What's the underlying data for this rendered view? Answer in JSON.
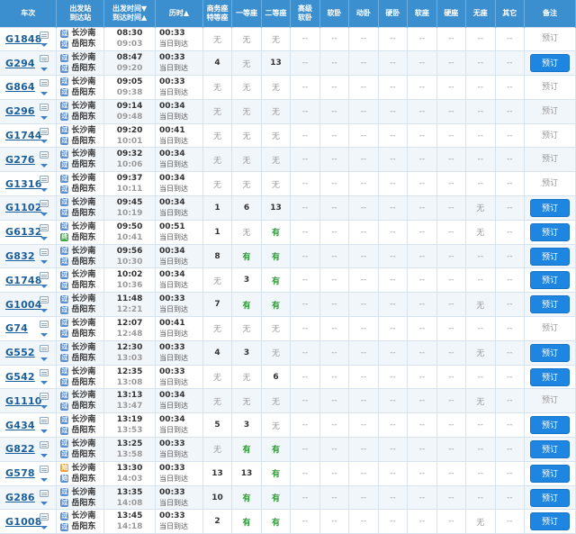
{
  "header": [
    {
      "key": "train",
      "lines": [
        "车次"
      ]
    },
    {
      "key": "station",
      "lines": [
        "出发站",
        "到达站"
      ]
    },
    {
      "key": "time",
      "lines": [
        "出发时间▼",
        "到达时间▲"
      ]
    },
    {
      "key": "duration",
      "lines": [
        "历时▲"
      ]
    },
    {
      "key": "biz",
      "lines": [
        "商务座",
        "特等座"
      ]
    },
    {
      "key": "first",
      "lines": [
        "一等座"
      ]
    },
    {
      "key": "second",
      "lines": [
        "二等座"
      ]
    },
    {
      "key": "gjrw",
      "lines": [
        "高级",
        "软卧"
      ]
    },
    {
      "key": "rw",
      "lines": [
        "软卧"
      ]
    },
    {
      "key": "dw",
      "lines": [
        "动卧"
      ]
    },
    {
      "key": "yw",
      "lines": [
        "硬卧"
      ]
    },
    {
      "key": "rz",
      "lines": [
        "软座"
      ]
    },
    {
      "key": "yz",
      "lines": [
        "硬座"
      ]
    },
    {
      "key": "wz",
      "lines": [
        "无座"
      ]
    },
    {
      "key": "qt",
      "lines": [
        "其它"
      ]
    },
    {
      "key": "note",
      "lines": [
        "备注"
      ]
    }
  ],
  "colors": {
    "header_bg": "#3c8fcf",
    "book_btn": "#1e86e0",
    "you": "#2f9a36",
    "train_link": "#1a5e9a"
  },
  "rows": [
    {
      "train": "G1848",
      "from": "长沙南",
      "from_icon": "过",
      "to": "岳阳东",
      "dep": "08:30",
      "arr": "09:03",
      "dur": "00:33",
      "note_text": "当日到达",
      "biz": "无",
      "first": "无",
      "second": "无",
      "gjrw": "--",
      "rw": "--",
      "dw": "--",
      "yw": "--",
      "rz": "--",
      "yz": "--",
      "wz": "--",
      "qt": "--",
      "book": "预订",
      "bookable": false
    },
    {
      "train": "G294",
      "from": "长沙南",
      "from_icon": "过",
      "to": "岳阳东",
      "dep": "08:47",
      "arr": "09:20",
      "dur": "00:33",
      "note_text": "当日到达",
      "biz": "4",
      "first": "无",
      "second": "13",
      "gjrw": "--",
      "rw": "--",
      "dw": "--",
      "yw": "--",
      "rz": "--",
      "yz": "--",
      "wz": "--",
      "qt": "--",
      "book": "预订",
      "bookable": true
    },
    {
      "train": "G864",
      "from": "长沙南",
      "from_icon": "过",
      "to": "岳阳东",
      "dep": "09:05",
      "arr": "09:38",
      "dur": "00:33",
      "note_text": "当日到达",
      "biz": "无",
      "first": "无",
      "second": "无",
      "gjrw": "--",
      "rw": "--",
      "dw": "--",
      "yw": "--",
      "rz": "--",
      "yz": "--",
      "wz": "--",
      "qt": "--",
      "book": "预订",
      "bookable": false
    },
    {
      "train": "G296",
      "from": "长沙南",
      "from_icon": "过",
      "to": "岳阳东",
      "dep": "09:14",
      "arr": "09:48",
      "dur": "00:34",
      "note_text": "当日到达",
      "biz": "无",
      "first": "无",
      "second": "无",
      "gjrw": "--",
      "rw": "--",
      "dw": "--",
      "yw": "--",
      "rz": "--",
      "yz": "--",
      "wz": "--",
      "qt": "--",
      "book": "预订",
      "bookable": false
    },
    {
      "train": "G1744",
      "from": "长沙南",
      "from_icon": "过",
      "to": "岳阳东",
      "dep": "09:20",
      "arr": "10:01",
      "dur": "00:41",
      "note_text": "当日到达",
      "biz": "无",
      "first": "无",
      "second": "无",
      "gjrw": "--",
      "rw": "--",
      "dw": "--",
      "yw": "--",
      "rz": "--",
      "yz": "--",
      "wz": "--",
      "qt": "--",
      "book": "预订",
      "bookable": false
    },
    {
      "train": "G276",
      "from": "长沙南",
      "from_icon": "过",
      "to": "岳阳东",
      "dep": "09:32",
      "arr": "10:06",
      "dur": "00:34",
      "note_text": "当日到达",
      "biz": "无",
      "first": "无",
      "second": "无",
      "gjrw": "--",
      "rw": "--",
      "dw": "--",
      "yw": "--",
      "rz": "--",
      "yz": "--",
      "wz": "--",
      "qt": "--",
      "book": "预订",
      "bookable": false
    },
    {
      "train": "G1316",
      "from": "长沙南",
      "from_icon": "过",
      "to": "岳阳东",
      "dep": "09:37",
      "arr": "10:11",
      "dur": "00:34",
      "note_text": "当日到达",
      "biz": "无",
      "first": "无",
      "second": "无",
      "gjrw": "--",
      "rw": "--",
      "dw": "--",
      "yw": "--",
      "rz": "--",
      "yz": "--",
      "wz": "--",
      "qt": "--",
      "book": "预订",
      "bookable": false
    },
    {
      "train": "G1102",
      "from": "长沙南",
      "from_icon": "过",
      "to": "岳阳东",
      "dep": "09:45",
      "arr": "10:19",
      "dur": "00:34",
      "note_text": "当日到达",
      "biz": "1",
      "first": "6",
      "second": "13",
      "gjrw": "--",
      "rw": "--",
      "dw": "--",
      "yw": "--",
      "rz": "--",
      "yz": "--",
      "wz": "无",
      "qt": "--",
      "book": "预订",
      "bookable": true
    },
    {
      "train": "G6132",
      "from": "长沙南",
      "from_icon": "过",
      "to": "岳阳东",
      "to_icon": "终",
      "dep": "09:50",
      "arr": "10:41",
      "dur": "00:51",
      "note_text": "当日到达",
      "biz": "1",
      "first": "无",
      "second": "有",
      "gjrw": "--",
      "rw": "--",
      "dw": "--",
      "yw": "--",
      "rz": "--",
      "yz": "--",
      "wz": "无",
      "qt": "--",
      "book": "预订",
      "bookable": true
    },
    {
      "train": "G832",
      "from": "长沙南",
      "from_icon": "过",
      "to": "岳阳东",
      "dep": "09:56",
      "arr": "10:30",
      "dur": "00:34",
      "note_text": "当日到达",
      "biz": "8",
      "first": "有",
      "second": "有",
      "gjrw": "--",
      "rw": "--",
      "dw": "--",
      "yw": "--",
      "rz": "--",
      "yz": "--",
      "wz": "--",
      "qt": "--",
      "book": "预订",
      "bookable": true
    },
    {
      "train": "G1748",
      "from": "长沙南",
      "from_icon": "过",
      "to": "岳阳东",
      "dep": "10:02",
      "arr": "10:36",
      "dur": "00:34",
      "note_text": "当日到达",
      "biz": "无",
      "first": "3",
      "second": "有",
      "gjrw": "--",
      "rw": "--",
      "dw": "--",
      "yw": "--",
      "rz": "--",
      "yz": "--",
      "wz": "--",
      "qt": "--",
      "book": "预订",
      "bookable": true
    },
    {
      "train": "G1004",
      "from": "长沙南",
      "from_icon": "过",
      "to": "岳阳东",
      "dep": "11:48",
      "arr": "12:21",
      "dur": "00:33",
      "note_text": "当日到达",
      "biz": "7",
      "first": "有",
      "second": "有",
      "gjrw": "--",
      "rw": "--",
      "dw": "--",
      "yw": "--",
      "rz": "--",
      "yz": "--",
      "wz": "无",
      "qt": "--",
      "book": "预订",
      "bookable": true
    },
    {
      "train": "G74",
      "from": "长沙南",
      "from_icon": "过",
      "to": "岳阳东",
      "dep": "12:07",
      "arr": "12:48",
      "dur": "00:41",
      "note_text": "当日到达",
      "biz": "无",
      "first": "无",
      "second": "无",
      "gjrw": "--",
      "rw": "--",
      "dw": "--",
      "yw": "--",
      "rz": "--",
      "yz": "--",
      "wz": "--",
      "qt": "--",
      "book": "预订",
      "bookable": false
    },
    {
      "train": "G552",
      "from": "长沙南",
      "from_icon": "过",
      "to": "岳阳东",
      "dep": "12:30",
      "arr": "13:03",
      "dur": "00:33",
      "note_text": "当日到达",
      "biz": "4",
      "first": "3",
      "second": "无",
      "gjrw": "--",
      "rw": "--",
      "dw": "--",
      "yw": "--",
      "rz": "--",
      "yz": "--",
      "wz": "无",
      "qt": "--",
      "book": "预订",
      "bookable": true
    },
    {
      "train": "G542",
      "from": "长沙南",
      "from_icon": "过",
      "to": "岳阳东",
      "dep": "12:35",
      "arr": "13:08",
      "dur": "00:33",
      "note_text": "当日到达",
      "biz": "无",
      "first": "无",
      "second": "6",
      "gjrw": "--",
      "rw": "--",
      "dw": "--",
      "yw": "--",
      "rz": "--",
      "yz": "--",
      "wz": "--",
      "qt": "--",
      "book": "预订",
      "bookable": true
    },
    {
      "train": "G1110",
      "from": "长沙南",
      "from_icon": "过",
      "to": "岳阳东",
      "dep": "13:13",
      "arr": "13:47",
      "dur": "00:34",
      "note_text": "当日到达",
      "biz": "无",
      "first": "无",
      "second": "无",
      "gjrw": "--",
      "rw": "--",
      "dw": "--",
      "yw": "--",
      "rz": "--",
      "yz": "--",
      "wz": "无",
      "qt": "--",
      "book": "预订",
      "bookable": false
    },
    {
      "train": "G434",
      "from": "长沙南",
      "from_icon": "过",
      "to": "岳阳东",
      "dep": "13:19",
      "arr": "13:53",
      "dur": "00:34",
      "note_text": "当日到达",
      "biz": "5",
      "first": "3",
      "second": "无",
      "gjrw": "--",
      "rw": "--",
      "dw": "--",
      "yw": "--",
      "rz": "--",
      "yz": "--",
      "wz": "--",
      "qt": "--",
      "book": "预订",
      "bookable": true
    },
    {
      "train": "G822",
      "from": "长沙南",
      "from_icon": "过",
      "to": "岳阳东",
      "dep": "13:25",
      "arr": "13:58",
      "dur": "00:33",
      "note_text": "当日到达",
      "biz": "无",
      "first": "有",
      "second": "有",
      "gjrw": "--",
      "rw": "--",
      "dw": "--",
      "yw": "--",
      "rz": "--",
      "yz": "--",
      "wz": "--",
      "qt": "--",
      "book": "预订",
      "bookable": true
    },
    {
      "train": "G578",
      "from": "长沙南",
      "from_icon": "始",
      "to": "岳阳东",
      "dep": "13:30",
      "arr": "14:03",
      "dur": "00:33",
      "note_text": "当日到达",
      "biz": "13",
      "first": "13",
      "second": "有",
      "gjrw": "--",
      "rw": "--",
      "dw": "--",
      "yw": "--",
      "rz": "--",
      "yz": "--",
      "wz": "--",
      "qt": "--",
      "book": "预订",
      "bookable": true
    },
    {
      "train": "G286",
      "from": "长沙南",
      "from_icon": "过",
      "to": "岳阳东",
      "dep": "13:35",
      "arr": "14:08",
      "dur": "00:33",
      "note_text": "当日到达",
      "biz": "10",
      "first": "有",
      "second": "有",
      "gjrw": "--",
      "rw": "--",
      "dw": "--",
      "yw": "--",
      "rz": "--",
      "yz": "--",
      "wz": "--",
      "qt": "--",
      "book": "预订",
      "bookable": true
    },
    {
      "train": "G1008",
      "from": "长沙南",
      "from_icon": "过",
      "to": "岳阳东",
      "dep": "13:45",
      "arr": "14:18",
      "dur": "00:33",
      "note_text": "当日到达",
      "biz": "2",
      "first": "有",
      "second": "有",
      "gjrw": "--",
      "rw": "--",
      "dw": "--",
      "yw": "--",
      "rz": "--",
      "yz": "--",
      "wz": "无",
      "qt": "--",
      "book": "预订",
      "bookable": true
    }
  ]
}
